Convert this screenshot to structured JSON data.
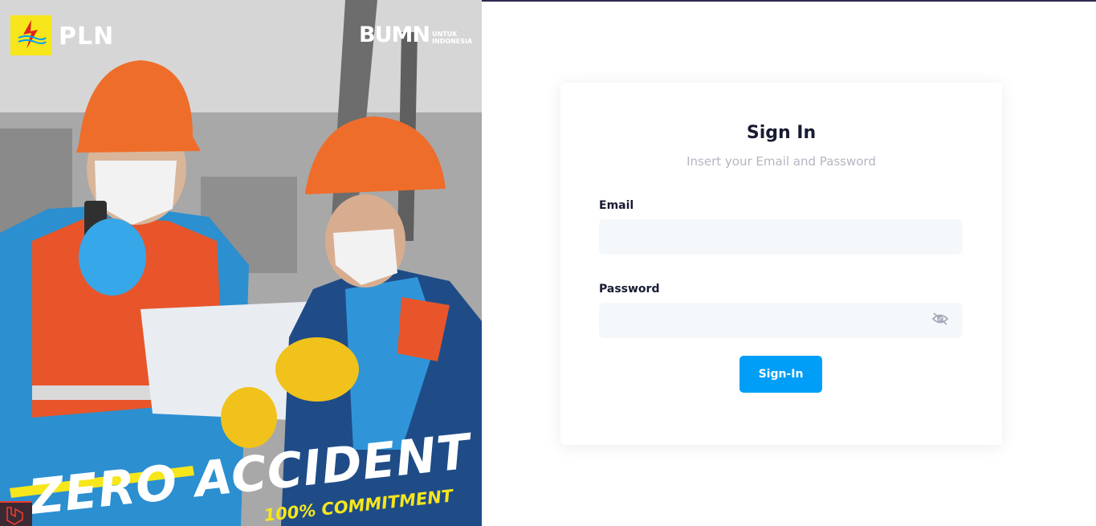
{
  "poster": {
    "brand_left": "PLN",
    "brand_right": "BUMN",
    "brand_right_sub_line1": "UNTUK",
    "brand_right_sub_line2": "INDONESIA",
    "headline": "ZERO ACCIDENT",
    "subheadline": "100% COMMITMENT",
    "icons": [
      "pln-logo-icon",
      "laravel-icon"
    ]
  },
  "login": {
    "title": "Sign In",
    "subtitle": "Insert your Email and Password",
    "email_label": "Email",
    "email_value": "",
    "password_label": "Password",
    "password_value": "",
    "submit_label": "Sign-In"
  },
  "colors": {
    "accent": "#009ef7",
    "input_bg": "#f5f8fa",
    "title": "#181c32",
    "muted": "#b5b5c3",
    "pln_yellow": "#f6e61b"
  }
}
